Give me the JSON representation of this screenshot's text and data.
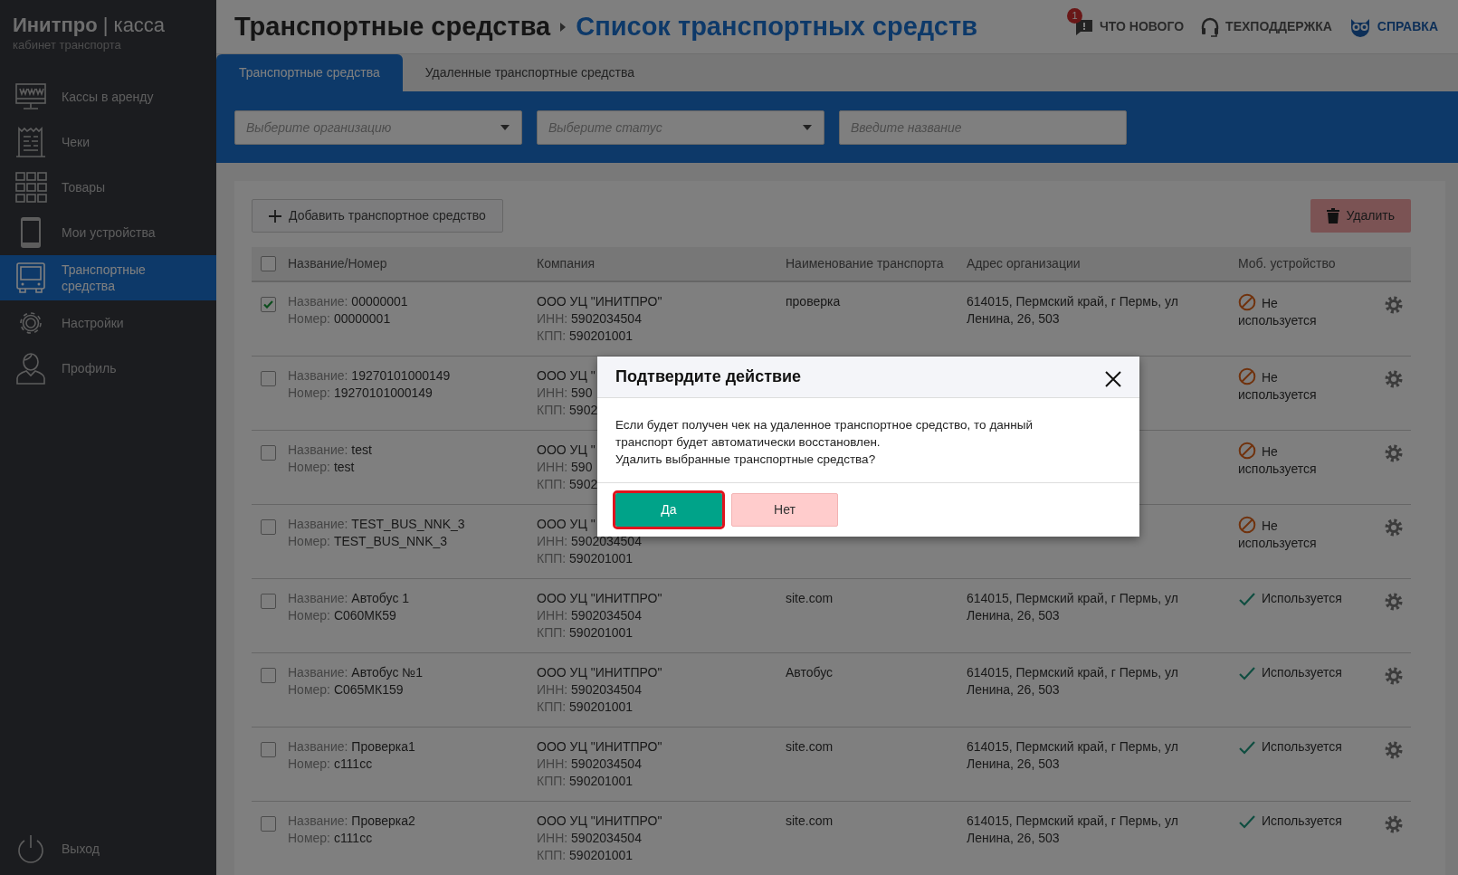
{
  "sidebar": {
    "brand": "Инитпро",
    "separator": "|",
    "brand_product": "касса",
    "subtitle": "кабинет транспорта",
    "items": [
      {
        "label": "Кассы в аренду",
        "selected": false
      },
      {
        "label": "Чеки",
        "selected": false
      },
      {
        "label": "Товары",
        "selected": false
      },
      {
        "label": "Мои устройства",
        "selected": false
      },
      {
        "label": "Транспортные средства",
        "selected": true
      },
      {
        "label": "Настройки",
        "selected": false
      },
      {
        "label": "Профиль",
        "selected": false
      }
    ],
    "logout": "Выход"
  },
  "header": {
    "breadcrumb": [
      "Транспортные средства",
      "Список транспортных средств"
    ],
    "links": [
      {
        "label": "ЧТО НОВОГО",
        "badge": "1"
      },
      {
        "label": "ТЕХПОДДЕРЖКА"
      },
      {
        "label": "СПРАВКА"
      }
    ]
  },
  "tabs": [
    {
      "label": "Транспортные средства",
      "selected": true
    },
    {
      "label": "Удаленные транспортные средства",
      "selected": false
    }
  ],
  "filters": [
    {
      "kind": "select",
      "placeholder": "Выберите организацию"
    },
    {
      "kind": "select",
      "placeholder": "Выберите статус"
    },
    {
      "kind": "text",
      "placeholder": "Введите название"
    }
  ],
  "toolbar": {
    "add_button": "Добавить транспортное средство",
    "delete_button": "Удалить"
  },
  "table": {
    "columns": [
      "Название/Номер",
      "Компания",
      "Наименование транспорта",
      "Адрес организации",
      "Моб. устройство"
    ],
    "header_checked": false,
    "rows": [
      {
        "checked": true,
        "name_label": "Название:",
        "name": "00000001",
        "number_label": "Номер:",
        "number": "00000001",
        "company": "ООО УЦ \"ИНИТПРО\"",
        "inn_label": "ИНН:",
        "inn": "5902034504",
        "kpp_label": "КПП:",
        "kpp": "590201001",
        "transport": "проверка",
        "address": "614015, Пермский край, г Пермь, ул Ленина, 26, 503",
        "device_in_use": false,
        "device_status": "Не используется"
      },
      {
        "checked": false,
        "name_label": "Название:",
        "name": "19270101000149",
        "number_label": "Номер:",
        "number": "19270101000149",
        "company": "ООО УЦ \"",
        "inn_label": "ИНН:",
        "inn": "590",
        "kpp_label": "КПП:",
        "kpp": "5902",
        "device_in_use": false,
        "device_status": "Не используется"
      },
      {
        "checked": false,
        "name_label": "Название:",
        "name": "test",
        "number_label": "Номер:",
        "number": "test",
        "company": "ООО УЦ \"",
        "inn_label": "ИНН:",
        "inn": "590",
        "kpp_label": "КПП:",
        "kpp": "5902",
        "device_in_use": false,
        "device_status": "Не используется"
      },
      {
        "checked": false,
        "name_label": "Название:",
        "name": "TEST_BUS_NNK_3",
        "number_label": "Номер:",
        "number": "TEST_BUS_NNK_3",
        "company": "ООО УЦ \"",
        "inn_label": "ИНН:",
        "inn": "5902034504",
        "kpp_label": "КПП:",
        "kpp": "590201001",
        "device_in_use": false,
        "device_status": "Не используется"
      },
      {
        "checked": false,
        "name_label": "Название:",
        "name": "Автобус 1",
        "number_label": "Номер:",
        "number": "С060МК59",
        "company": "ООО УЦ \"ИНИТПРО\"",
        "inn_label": "ИНН:",
        "inn": "5902034504",
        "kpp_label": "КПП:",
        "kpp": "590201001",
        "transport": "site.com",
        "address": "614015, Пермский край, г Пермь, ул Ленина, 26, 503",
        "device_in_use": true,
        "device_status": "Используется"
      },
      {
        "checked": false,
        "name_label": "Название:",
        "name": "Автобус №1",
        "number_label": "Номер:",
        "number": "С065МК159",
        "company": "ООО УЦ \"ИНИТПРО\"",
        "inn_label": "ИНН:",
        "inn": "5902034504",
        "kpp_label": "КПП:",
        "kpp": "590201001",
        "transport": "Автобус",
        "address": "614015, Пермский край, г Пермь, ул Ленина, 26, 503",
        "device_in_use": true,
        "device_status": "Используется"
      },
      {
        "checked": false,
        "name_label": "Название:",
        "name": "Проверка1",
        "number_label": "Номер:",
        "number": "c111cc",
        "company": "ООО УЦ \"ИНИТПРО\"",
        "inn_label": "ИНН:",
        "inn": "5902034504",
        "kpp_label": "КПП:",
        "kpp": "590201001",
        "transport": "site.com",
        "address": "614015, Пермский край, г Пермь, ул Ленина, 26, 503",
        "device_in_use": true,
        "device_status": "Используется"
      },
      {
        "checked": false,
        "name_label": "Название:",
        "name": "Проверка2",
        "number_label": "Номер:",
        "number": "c111cc",
        "company": "ООО УЦ \"ИНИТПРО\"",
        "inn_label": "ИНН:",
        "inn": "5902034504",
        "kpp_label": "КПП:",
        "kpp": "590201001",
        "transport": "site.com",
        "address": "614015, Пермский край, г Пермь, ул Ленина, 26, 503",
        "device_in_use": true,
        "device_status": "Используется"
      }
    ]
  },
  "modal": {
    "title": "Подтвердите действие",
    "body": [
      "Если будет получен чек на удаленное транспортное средство, то данный транспорт будет автоматически восстановлен.",
      "Удалить выбранные транспортные средства?"
    ],
    "buttons": [
      {
        "kind": "confirm",
        "label": "Да",
        "focused": true
      },
      {
        "kind": "cancel",
        "label": "Нет",
        "focused": false
      }
    ]
  }
}
